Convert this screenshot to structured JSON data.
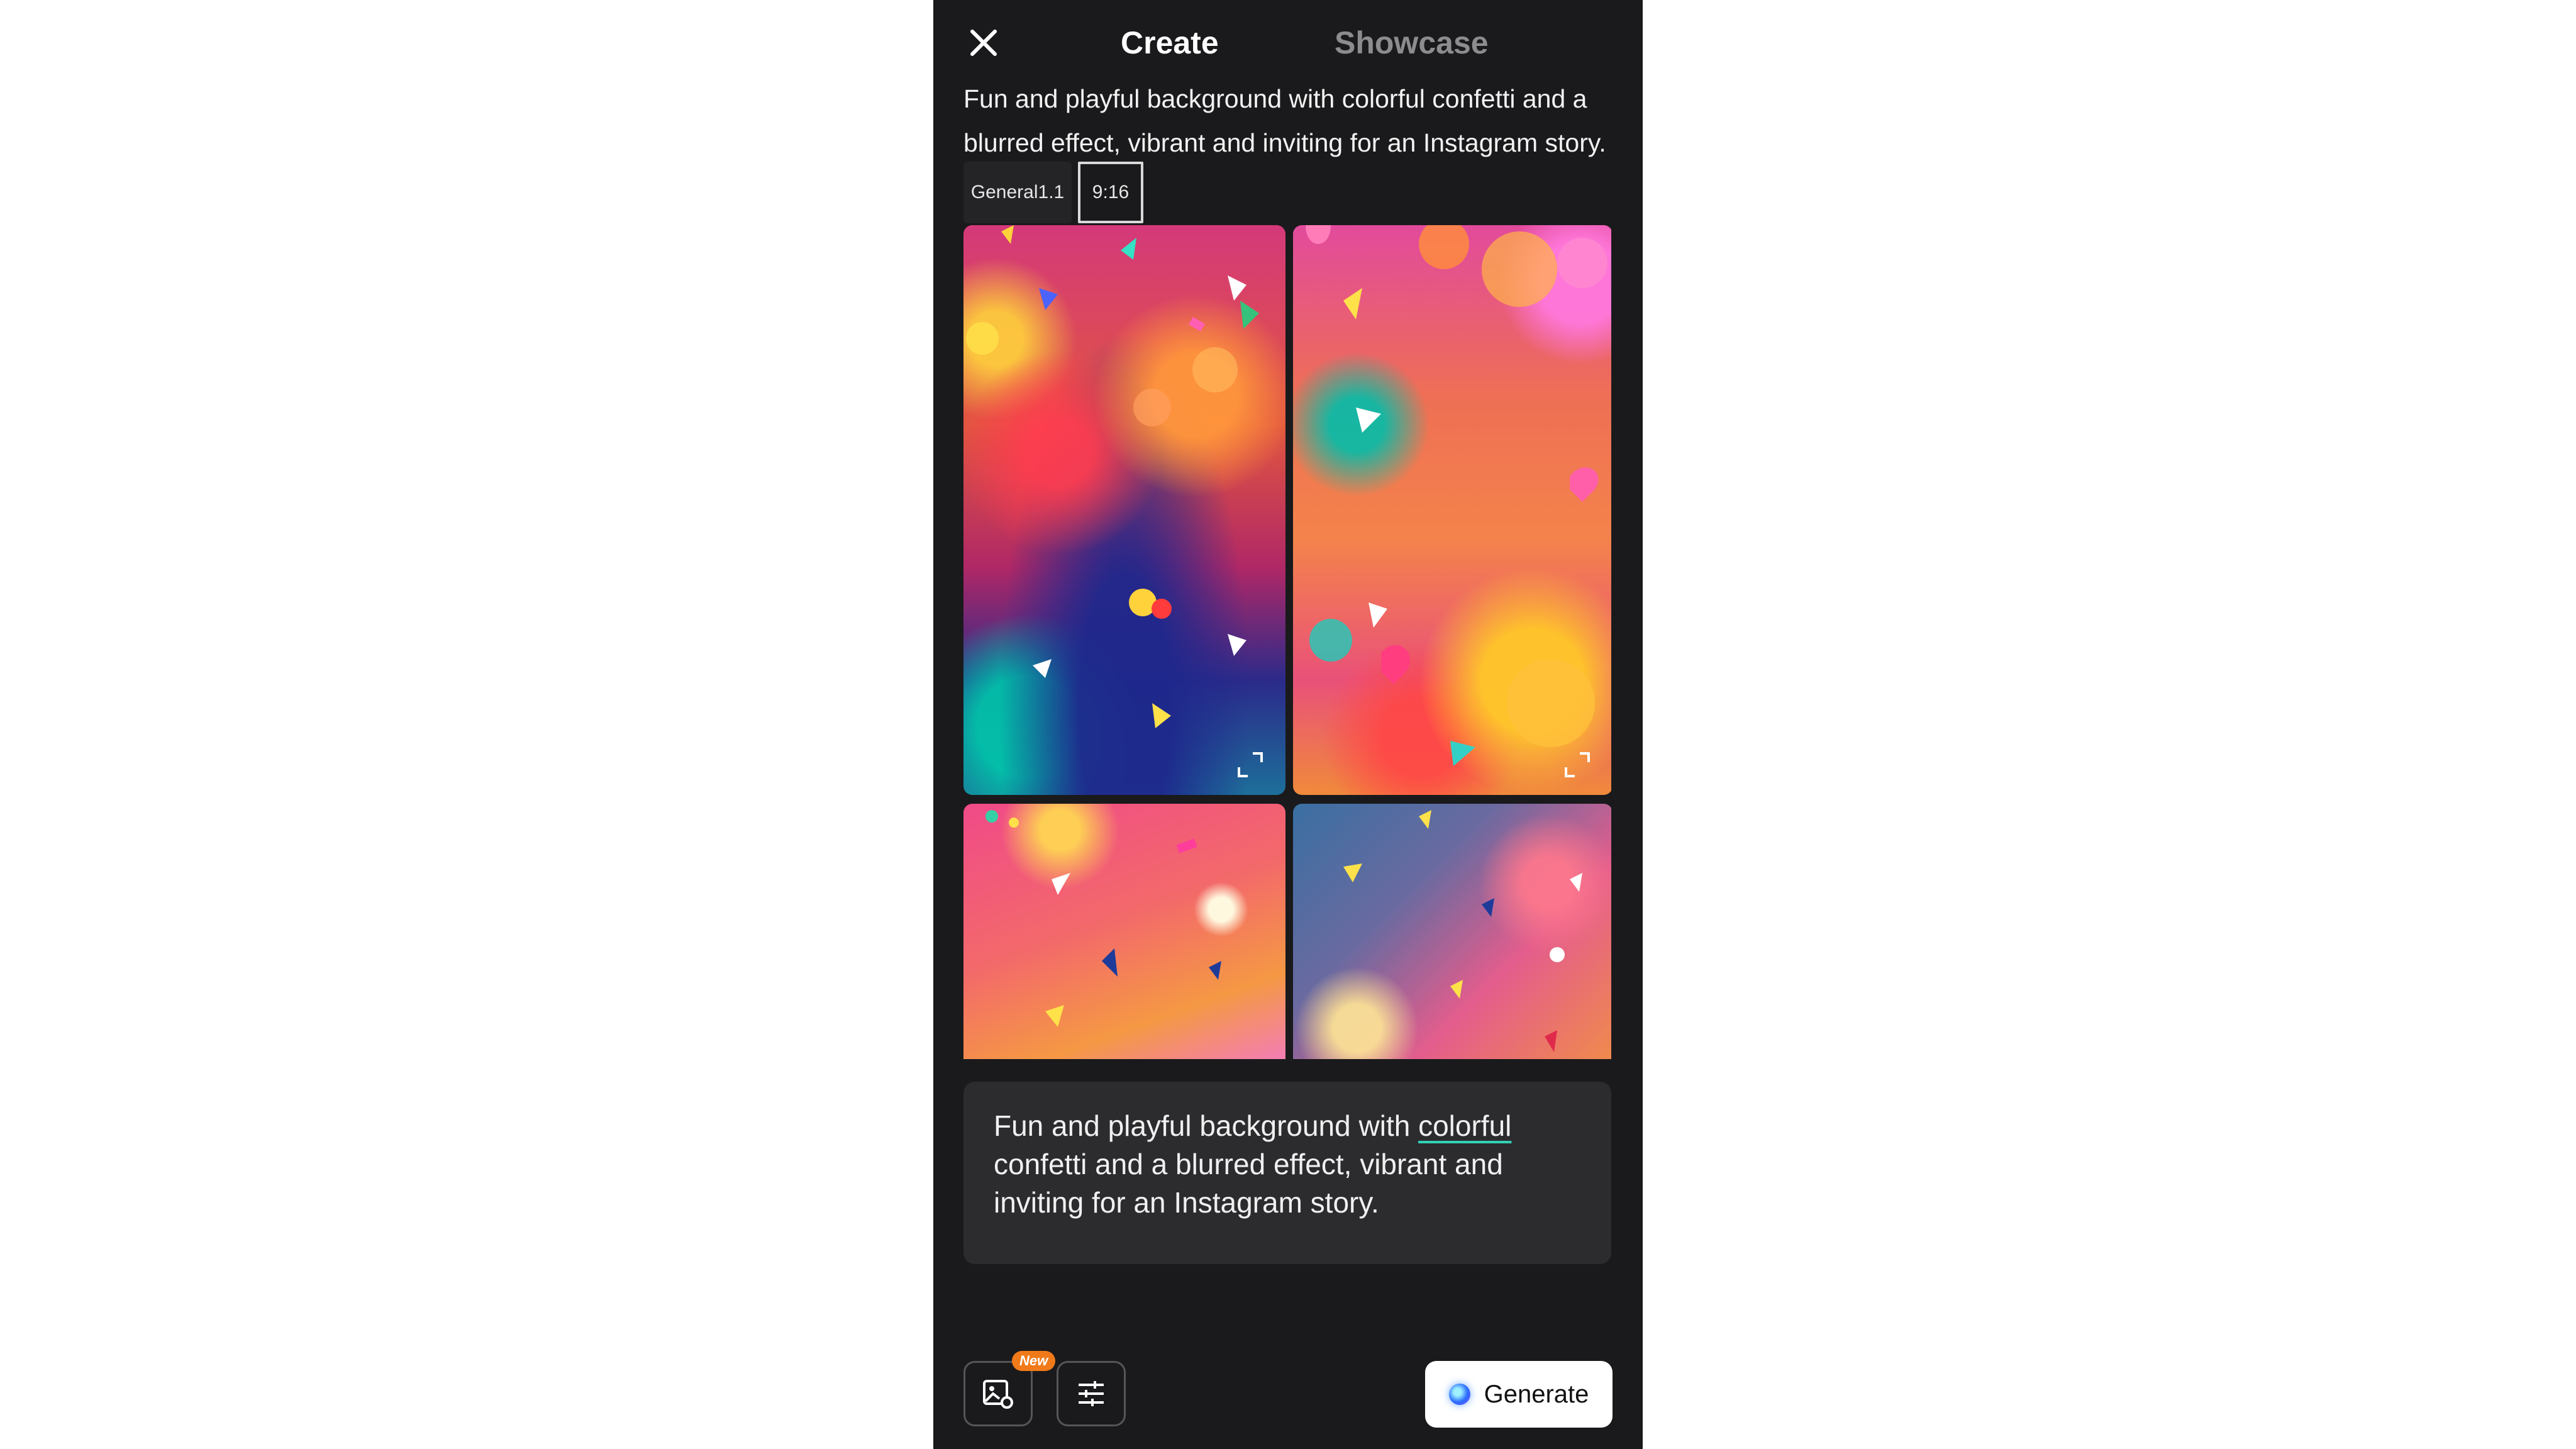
{
  "header": {
    "tabs": [
      {
        "label": "Create",
        "active": true
      },
      {
        "label": "Showcase",
        "active": false
      }
    ]
  },
  "prompt_summary": "Fun and playful background with colorful confetti and a blurred effect, vibrant and inviting for an Instagram story.",
  "chips": {
    "model": "General1.1",
    "ratio": "9:16"
  },
  "images": [
    {
      "name": "result-1"
    },
    {
      "name": "result-2"
    },
    {
      "name": "result-3"
    },
    {
      "name": "result-4"
    }
  ],
  "prompt_input": {
    "before": "Fun and playful background with ",
    "highlight": "colorful",
    "after": " confetti and a blurred effect, vibrant and inviting for an Instagram story."
  },
  "toolbar": {
    "new_badge": "New",
    "generate_label": "Generate"
  },
  "colors": {
    "background": "#1a1a1c",
    "panel": "#2c2c2f",
    "accent_underline": "#33d1b4",
    "badge": "#f07a1a"
  },
  "icons": [
    "close-icon",
    "image-settings-icon",
    "sliders-icon",
    "expand-icon",
    "ai-orb-icon"
  ]
}
